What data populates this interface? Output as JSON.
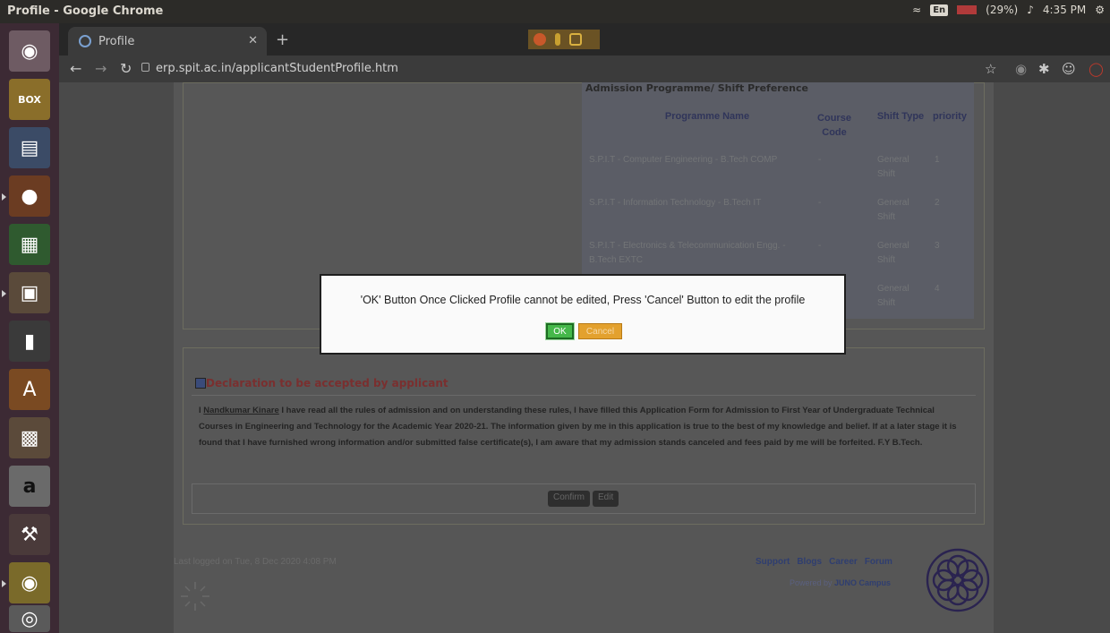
{
  "top_panel": {
    "window_title": "Profile - Google Chrome",
    "lang": "En",
    "battery": "(29%)",
    "time": "4:35 PM"
  },
  "browser": {
    "tab_title": "Profile",
    "url": "erp.spit.ac.in/applicantStudentProfile.htm"
  },
  "programme": {
    "title": "Admission Programme/ Shift Preference",
    "headers": [
      "Programme Name",
      "Course Code",
      "Shift Type",
      "priority"
    ],
    "rows": [
      {
        "name": "S.P.I.T - Computer Engineering - B.Tech COMP",
        "code": "-",
        "shift": "General Shift",
        "priority": "1"
      },
      {
        "name": "S.P.I.T - Information Technology - B.Tech IT",
        "code": "-",
        "shift": "General Shift",
        "priority": "2"
      },
      {
        "name": "S.P.I.T - Electronics & Telecommunication Engg. - B.Tech EXTC",
        "code": "-",
        "shift": "General Shift",
        "priority": "3"
      },
      {
        "name": "",
        "code": "",
        "shift": "General Shift",
        "priority": "4"
      }
    ]
  },
  "declaration": {
    "title": "Declaration to be accepted by applicant",
    "prefix": "I ",
    "name": "Nandkumar Kinare",
    "text": " I have read all the rules of admission and on understanding these rules, I have filled this Application Form for Admission to First Year of Undergraduate Technical Courses in Engineering and Technology for the Academic Year 2020-21. The information given by me in this application is true to the best of my knowledge and belief. If at a later stage it is found that I have furnished wrong information and/or submitted false certificate(s), I am aware that my admission stands canceled and fees paid by me will be forfeited. F.Y B.Tech.",
    "confirm_label": "Confirm",
    "edit_label": "Edit"
  },
  "footer": {
    "last_logged": "Last logged on Tue, 8 Dec 2020 4:08 PM",
    "links": [
      "Support",
      "Blogs",
      "Career",
      "Forum"
    ],
    "powered_prefix": "Powered by ",
    "powered_brand": "JUNO Campus"
  },
  "dialog": {
    "message": "'OK' Button Once Clicked Profile cannot be edited, Press 'Cancel' Button to edit the profile",
    "ok_label": "OK",
    "cancel_label": "Cancel"
  }
}
